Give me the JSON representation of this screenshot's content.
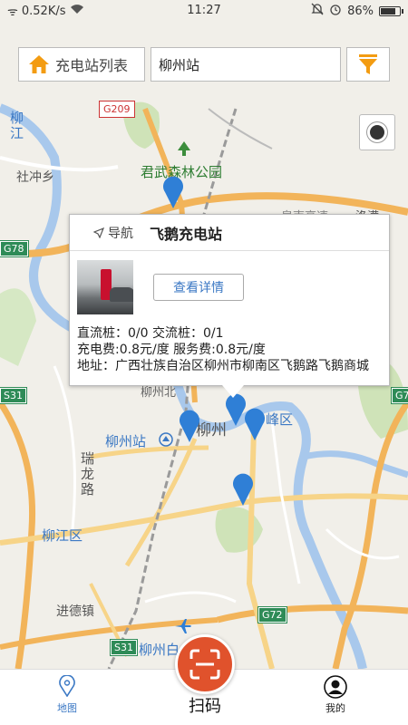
{
  "status_bar": {
    "signal_text": "ᯤ",
    "speed": "0.52K/s",
    "time": "11:27",
    "battery": "86%",
    "battery_level": 0.86
  },
  "toolbar": {
    "station_list_label": "充电站列表",
    "search_value": "柳州站"
  },
  "map_labels": {
    "forest_park": "君武森林公园",
    "shechong": "社冲乡",
    "liujiang_river": "柳江",
    "liuzhou_station": "柳州站",
    "ruilong_road": "瑞龙路",
    "liujiang_district": "柳江区",
    "jinde_town": "进德镇",
    "liuzhou_city": "柳州",
    "feng_district": "峰区",
    "liuzhou_bottom": "柳州白",
    "luoman": "洛满",
    "north_hwy": "泉南高速",
    "road_g209": "G209",
    "road_g78": "G78",
    "road_s31": "S31",
    "road_g72": "G72",
    "road_s31b": "S31",
    "road_g7": "G7",
    "liuzhou_north": "柳州北"
  },
  "info_window": {
    "nav_label": "导航",
    "station_name": "飞鹅充电站",
    "detail_button": "查看详情",
    "dc_ac_line": "直流桩：0/0   交流桩：0/1",
    "fee_line": "充电费:0.8元/度   服务费:0.8元/度",
    "address_line": "地址：广西壮族自治区柳州市柳南区飞鹅路飞鹅商城"
  },
  "bottom_nav": {
    "map_label": "地图",
    "scan_label": "扫码",
    "me_label": "我的"
  },
  "colors": {
    "accent_blue": "#3b78c4",
    "scan_orange": "#e0522c",
    "home_orange": "#f39c12",
    "marker_blue": "#2f7fd6"
  },
  "icons": {
    "home": "home-icon",
    "filter": "filter-icon",
    "locate": "locate-icon",
    "navigation": "navigation-arrow-icon",
    "map_pin": "map-pin-icon",
    "scan": "scan-icon",
    "user": "user-icon"
  }
}
